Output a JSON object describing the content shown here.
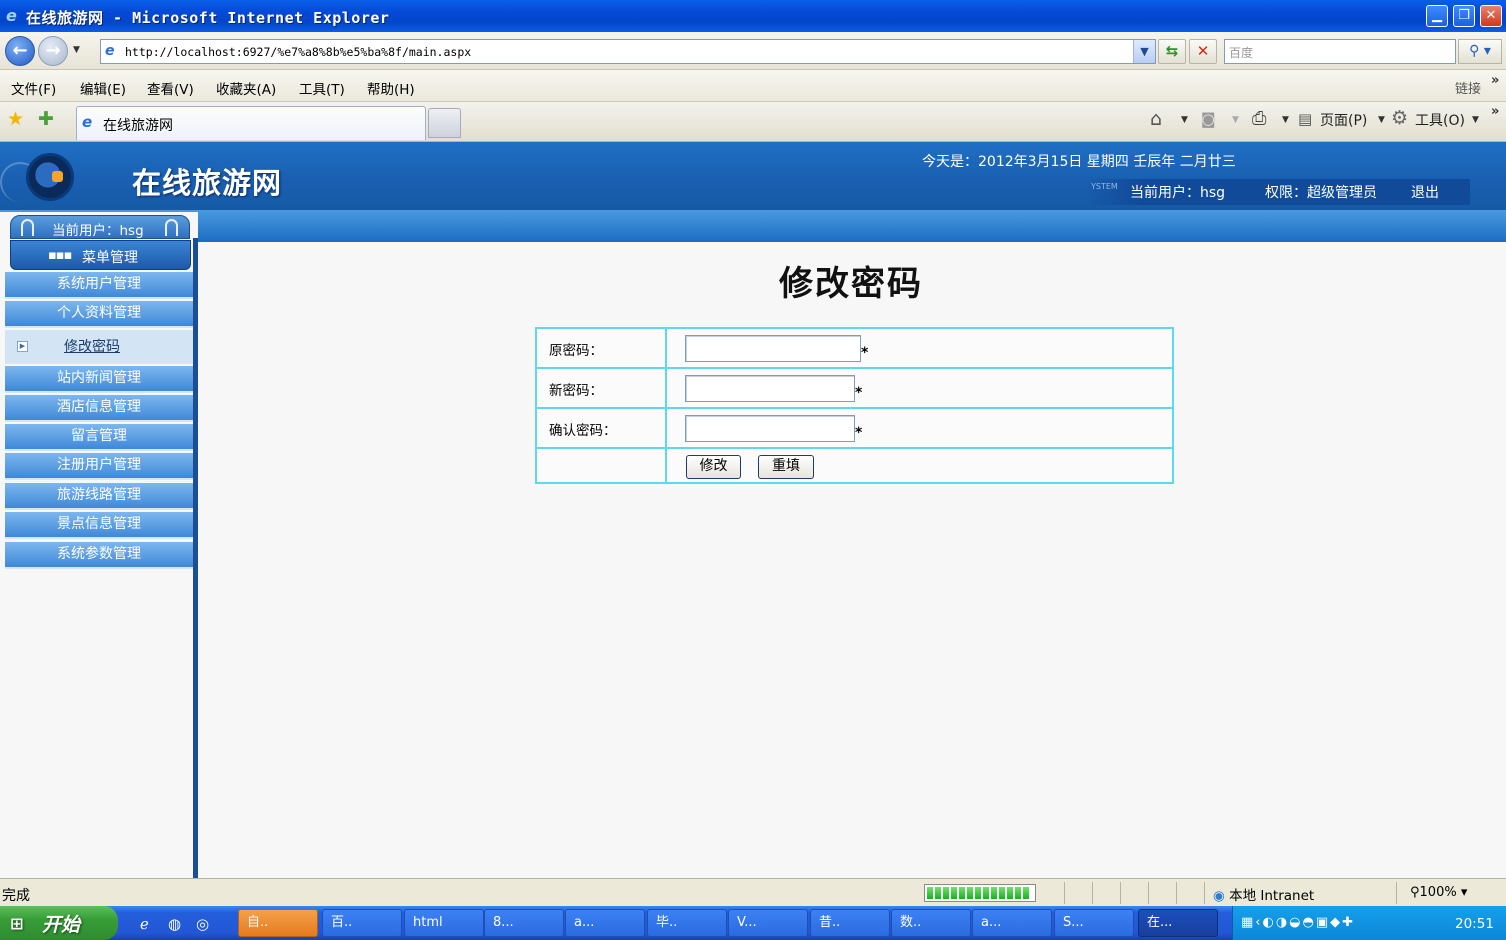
{
  "window": {
    "title": "在线旅游网 - Microsoft Internet Explorer"
  },
  "address": {
    "url": "http://localhost:6927/%e7%a8%8b%e5%ba%8f/main.aspx"
  },
  "search": {
    "placeholder": "百度"
  },
  "menubar": {
    "items": [
      "文件(F)",
      "编辑(E)",
      "查看(V)",
      "收藏夹(A)",
      "工具(T)",
      "帮助(H)"
    ],
    "links_label": "链接"
  },
  "tabs": {
    "active_label": "在线旅游网"
  },
  "commandbar": {
    "page_label": "页面(P)",
    "tools_label": "工具(O)"
  },
  "header": {
    "site_title": "在线旅游网",
    "date": "今天是：2012年3月15日 星期四 壬辰年 二月廿三",
    "current_user": "当前用户：hsg",
    "permission": "权限：超级管理员",
    "logout": "退出",
    "system_tag": "YSTEM"
  },
  "sidebar": {
    "user_label": "当前用户：hsg",
    "menu_title": "菜单管理",
    "items": [
      {
        "label": "系统用户管理",
        "active": false
      },
      {
        "label": "个人资料管理",
        "active": false
      },
      {
        "label": "修改密码",
        "active": true
      },
      {
        "label": "站内新闻管理",
        "active": false
      },
      {
        "label": "酒店信息管理",
        "active": false
      },
      {
        "label": "留言管理",
        "active": false
      },
      {
        "label": "注册用户管理",
        "active": false
      },
      {
        "label": "旅游线路管理",
        "active": false
      },
      {
        "label": "景点信息管理",
        "active": false
      },
      {
        "label": "系统参数管理",
        "active": false
      }
    ]
  },
  "form": {
    "title": "修改密码",
    "old_password_label": "原密码：",
    "new_password_label": "新密码：",
    "confirm_password_label": "确认密码：",
    "required_mark": "*",
    "submit_label": "修改",
    "reset_label": "重填"
  },
  "statusbar": {
    "status": "完成",
    "zone": "本地 Intranet",
    "zoom": "100%"
  },
  "taskbar": {
    "start_label": "开始",
    "tasks": [
      "自..",
      "百..",
      "html",
      "8...",
      "a...",
      "毕..",
      "V...",
      "昔..",
      "数..",
      "a...",
      "S...",
      "在..."
    ],
    "clock": "20:51"
  }
}
